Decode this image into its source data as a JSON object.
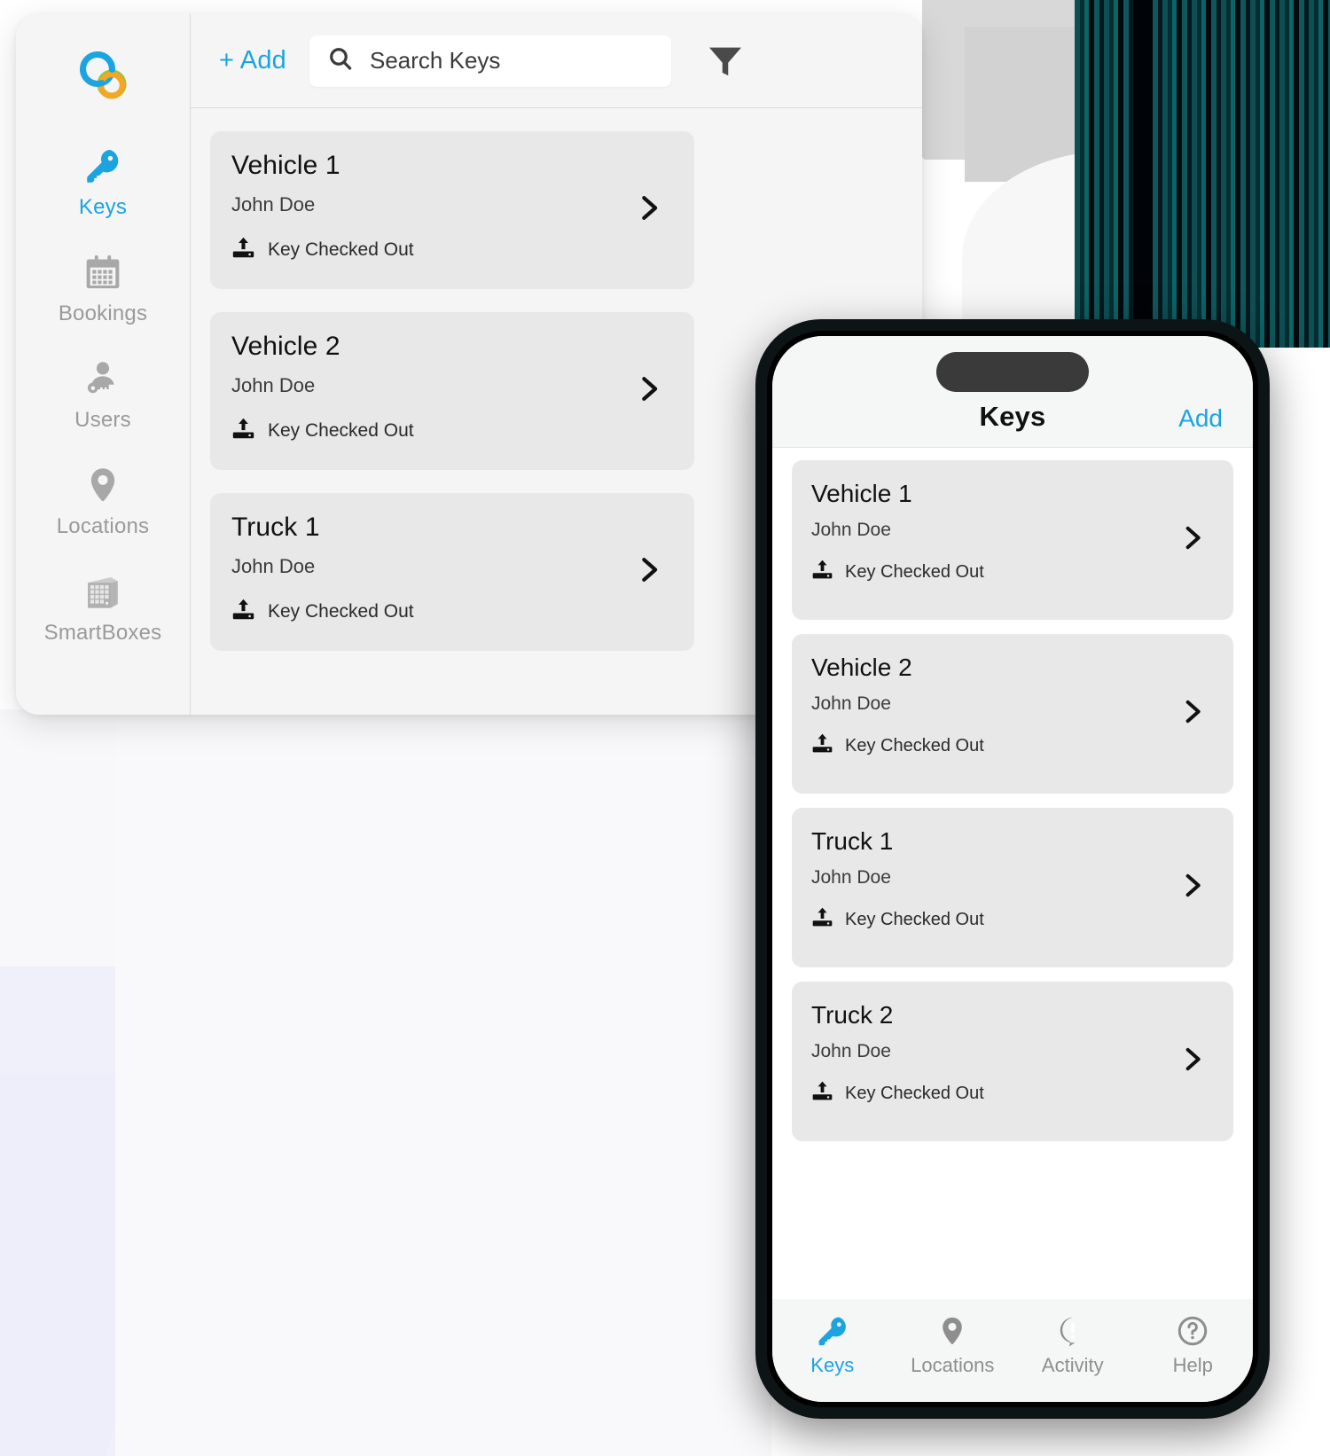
{
  "colors": {
    "accent_blue": "#1ba4e0",
    "logo_blue": "#1ba4e0",
    "logo_orange": "#f5a623",
    "logo_green": "#8dc63f",
    "card_gray": "#e8e8e8",
    "muted_gray": "#9a9a9a",
    "stripe_teal": "#0d4f53"
  },
  "desktop": {
    "sidebar": {
      "logo_name": "interlocking-rings-logo",
      "items": [
        {
          "label": "Keys",
          "icon": "key-icon",
          "active": true
        },
        {
          "label": "Bookings",
          "icon": "calendar-icon",
          "active": false
        },
        {
          "label": "Users",
          "icon": "user-key-icon",
          "active": false
        },
        {
          "label": "Locations",
          "icon": "map-pin-icon",
          "active": false
        },
        {
          "label": "SmartBoxes",
          "icon": "smartbox-grid-icon",
          "active": false
        }
      ]
    },
    "toolbar": {
      "add_label": "+ Add",
      "search_placeholder": "Search Keys",
      "search_value": "",
      "search_icon": "search-icon",
      "filter_icon": "filter-funnel-icon"
    },
    "cards": [
      {
        "title": "Vehicle 1",
        "subtitle": "John Doe",
        "status": "Key Checked Out",
        "status_icon": "key-checked-out-icon",
        "chevron": "chevron-right-icon"
      },
      {
        "title": "Vehicle 2",
        "subtitle": "John Doe",
        "status": "Key Checked Out",
        "status_icon": "key-checked-out-icon",
        "chevron": "chevron-right-icon"
      },
      {
        "title": "Truck 1",
        "subtitle": "John Doe",
        "status": "Key Checked Out",
        "status_icon": "key-checked-out-icon",
        "chevron": "chevron-right-icon"
      }
    ]
  },
  "phone": {
    "header": {
      "title": "Keys",
      "add_label": "Add"
    },
    "cards": [
      {
        "title": "Vehicle 1",
        "subtitle": "John Doe",
        "status": "Key Checked Out",
        "status_icon": "key-checked-out-icon",
        "chevron": "chevron-right-icon"
      },
      {
        "title": "Vehicle 2",
        "subtitle": "John Doe",
        "status": "Key Checked Out",
        "status_icon": "key-checked-out-icon",
        "chevron": "chevron-right-icon"
      },
      {
        "title": "Truck 1",
        "subtitle": "John Doe",
        "status": "Key Checked Out",
        "status_icon": "key-checked-out-icon",
        "chevron": "chevron-right-icon"
      },
      {
        "title": "Truck 2",
        "subtitle": "John Doe",
        "status": "Key Checked Out",
        "status_icon": "key-checked-out-icon",
        "chevron": "chevron-right-icon"
      }
    ],
    "tabs": [
      {
        "label": "Keys",
        "icon": "key-icon",
        "active": true
      },
      {
        "label": "Locations",
        "icon": "map-pin-icon",
        "active": false
      },
      {
        "label": "Activity",
        "icon": "alert-bubble-icon",
        "active": false
      },
      {
        "label": "Help",
        "icon": "question-circle-icon",
        "active": false
      }
    ]
  }
}
